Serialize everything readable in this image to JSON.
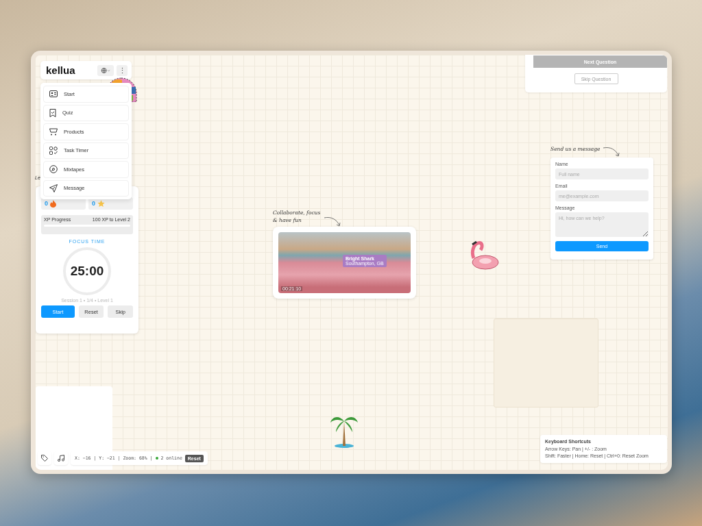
{
  "header": {
    "logo": "kellua",
    "more": "⋮"
  },
  "menu": [
    {
      "label": "Start",
      "kind": "card"
    },
    {
      "label": "Quiz",
      "kind": "badge"
    },
    {
      "label": "Products",
      "kind": "cart"
    },
    {
      "label": "Task Timer",
      "kind": "apps"
    },
    {
      "label": "Mixtapes",
      "kind": "disc"
    },
    {
      "label": "Message",
      "kind": "send"
    }
  ],
  "cut_label": "Le",
  "timer": {
    "streak": "0",
    "stars": "0",
    "xp_label": "XP Progress",
    "xp_goal": "100 XP to Level 2",
    "level": 0,
    "mode": "FOCUS TIME",
    "time": "25:00",
    "session": "Session 1 • 1/4 • Level 1",
    "buttons": [
      {
        "label": "Start",
        "primary": true
      },
      {
        "label": "Reset",
        "primary": false
      },
      {
        "label": "Skip",
        "primary": false
      }
    ]
  },
  "quiz": {
    "next": "Next Question",
    "skip": "Skip Question"
  },
  "video_card": {
    "caption": "Collaborate, focus\n& have fun",
    "tag_title": "Bright Shark",
    "tag_subtitle": "Southampton, GB",
    "timestamp": "00:21:10"
  },
  "message_form": {
    "caption": "Send us a message",
    "fields": [
      {
        "label": "Name",
        "placeholder": "Full name",
        "kind": "input"
      },
      {
        "label": "Email",
        "placeholder": "me@example.com",
        "kind": "input"
      },
      {
        "label": "Message",
        "placeholder": "Hi, how can we help?",
        "kind": "textarea"
      }
    ],
    "submit": "Send"
  },
  "status_bar": {
    "coords": "X: −16 | Y: −21 | Zoom: 68% |",
    "online": "2 online",
    "reset": "Reset"
  },
  "shortcuts": {
    "title": "Keyboard Shortcuts",
    "lines": [
      "Arrow Keys: Pan | +/- : Zoom",
      "Shift: Faster | Home: Reset | Ctrl+0: Reset Zoom"
    ]
  }
}
